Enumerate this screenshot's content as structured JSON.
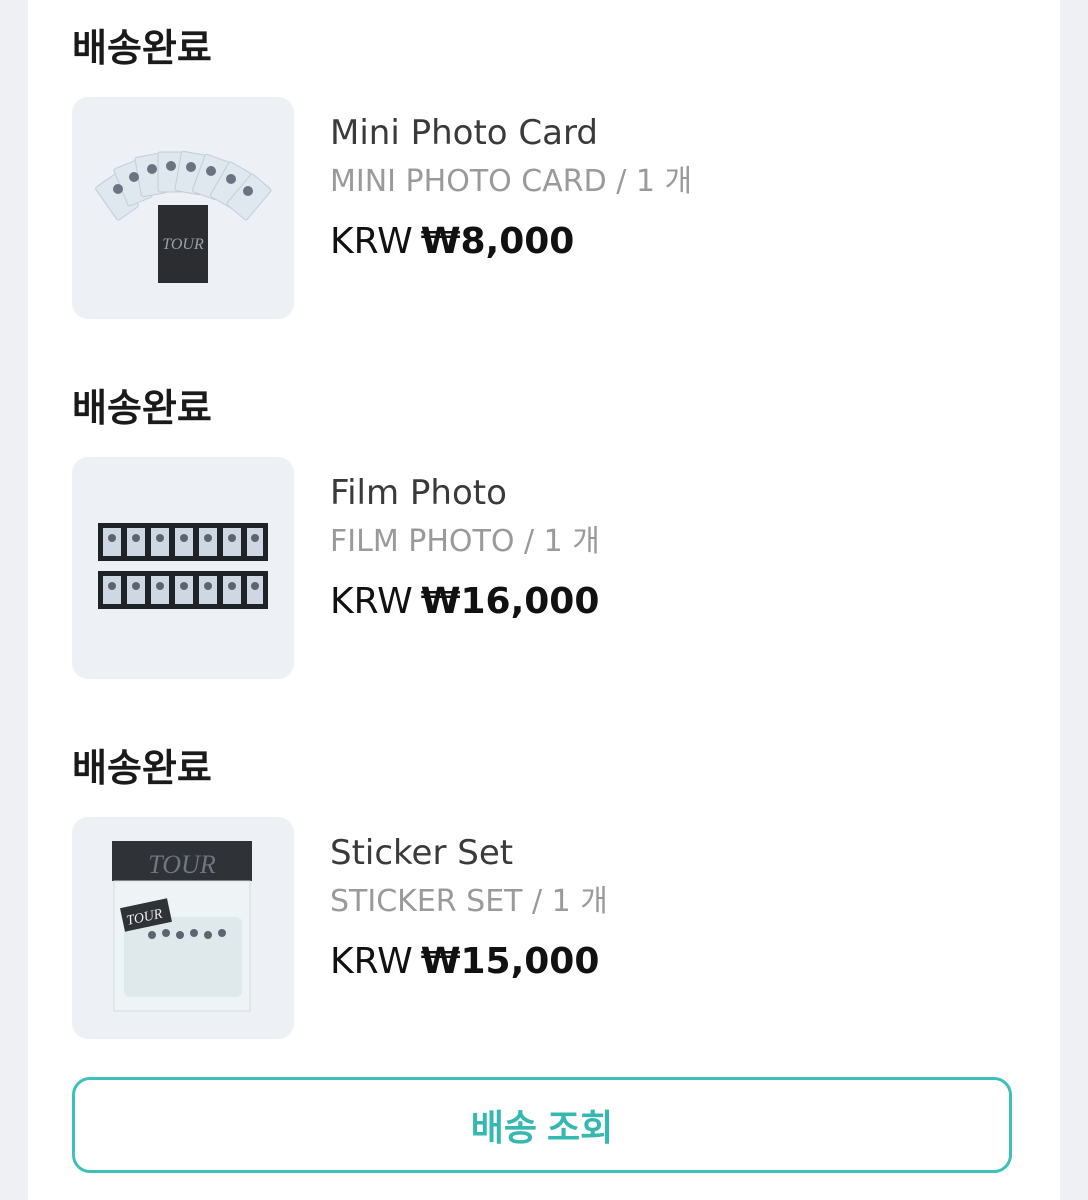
{
  "orders": [
    {
      "status": "배송완료",
      "name": "Mini Photo Card",
      "option": "MINI PHOTO CARD / 1 개",
      "currency": "KRW",
      "amount": "₩8,000",
      "thumb_icon": "photo-card-fan-image"
    },
    {
      "status": "배송완료",
      "name": "Film Photo",
      "option": "FILM PHOTO / 1 개",
      "currency": "KRW",
      "amount": "₩16,000",
      "thumb_icon": "film-strip-image"
    },
    {
      "status": "배송완료",
      "name": "Sticker Set",
      "option": "STICKER SET / 1 개",
      "currency": "KRW",
      "amount": "₩15,000",
      "thumb_icon": "sticker-set-image"
    }
  ],
  "track_button": {
    "label": "배송 조회"
  },
  "colors": {
    "accent": "#3cc0b9",
    "thumb_bg": "#edf0f5",
    "page_bg": "#eef0f4"
  }
}
